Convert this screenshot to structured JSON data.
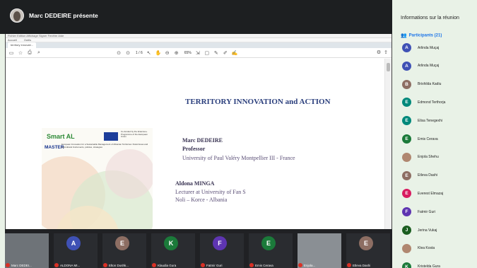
{
  "presenter": {
    "name": "Marc DEDEIRE présente"
  },
  "viewer": {
    "toolbar1": "Fichier  Edition  Affichage  Signer  Fenêtre  Aide",
    "toolbar2": [
      "Accueil",
      "Outils"
    ],
    "tab_active": "territory innovati...",
    "page_indicator": "1 / 6",
    "zoom": "65%"
  },
  "slide": {
    "title": "TERRITORY INNOVATION and ACTION",
    "logo_smart": "Smart AL",
    "logo_master": "MASTER",
    "eu_text": "Co-funded by the Erasmus+ Programme of the European Union",
    "master_sub": "European Innovation for a Sustainable Management of Albanian Territories: Rural Areas and Agricultural Instruments, policies, strategies",
    "author1_name": "Marc DEDEIRE",
    "author1_title": "Professor",
    "author1_affil": "University of Paul Valéry Montpellier III - France",
    "author2_name": "Aldona MINGA",
    "author2_title": "Lecturer at University of Fan S",
    "author2_affil": "Noli – Korce - Albania"
  },
  "sidebar": {
    "title": "Informations sur la réunion",
    "participants_label": "Participants (21)",
    "participants": [
      {
        "initial": "A",
        "name": "Arlinda Muçaj",
        "color": "#3f51b5"
      },
      {
        "initial": "A",
        "name": "Arlinda Muçaj",
        "color": "#3f51b5"
      },
      {
        "initial": "B",
        "name": "Brixhilda Kadiu",
        "color": "#8d6e63"
      },
      {
        "initial": "E",
        "name": "Edmond Terthorja",
        "color": "#00897b"
      },
      {
        "initial": "E",
        "name": "Elisa Tenegexhi",
        "color": "#00897b"
      },
      {
        "initial": "E",
        "name": "Emis Cerava",
        "color": "#1b7a3a"
      },
      {
        "initial": "",
        "name": "Enjola Shehu",
        "color": "#b08770"
      },
      {
        "initial": "E",
        "name": "Etleva Dashi",
        "color": "#8d6e63"
      },
      {
        "initial": "E",
        "name": "Everest Elmazaj",
        "color": "#d81b60"
      },
      {
        "initial": "F",
        "name": "Fatmir Guri",
        "color": "#5e35b1"
      },
      {
        "initial": "J",
        "name": "Jerina Vukaj",
        "color": "#1b5e20"
      },
      {
        "initial": "",
        "name": "Klea Kosta",
        "color": "#b08770"
      },
      {
        "initial": "K",
        "name": "Kristelda Gura",
        "color": "#1b7a3a"
      }
    ]
  },
  "tiles": [
    {
      "initial": "",
      "name": "Marc DEDEI...",
      "color": "#888"
    },
    {
      "initial": "A",
      "name": "ALDONA MI...",
      "color": "#3f51b5"
    },
    {
      "initial": "E",
      "name": "Elton Dushk...",
      "color": "#8d6e63"
    },
    {
      "initial": "K",
      "name": "Klaudia Gura",
      "color": "#1b7a3a"
    },
    {
      "initial": "F",
      "name": "Fatmir Guri",
      "color": "#5e35b1"
    },
    {
      "initial": "E",
      "name": "Emis Cerava",
      "color": "#1b7a3a"
    },
    {
      "initial": "",
      "name": "Enjola...",
      "color": "#888"
    },
    {
      "initial": "E",
      "name": "Etleva Dashi",
      "color": "#8d6e63"
    }
  ]
}
